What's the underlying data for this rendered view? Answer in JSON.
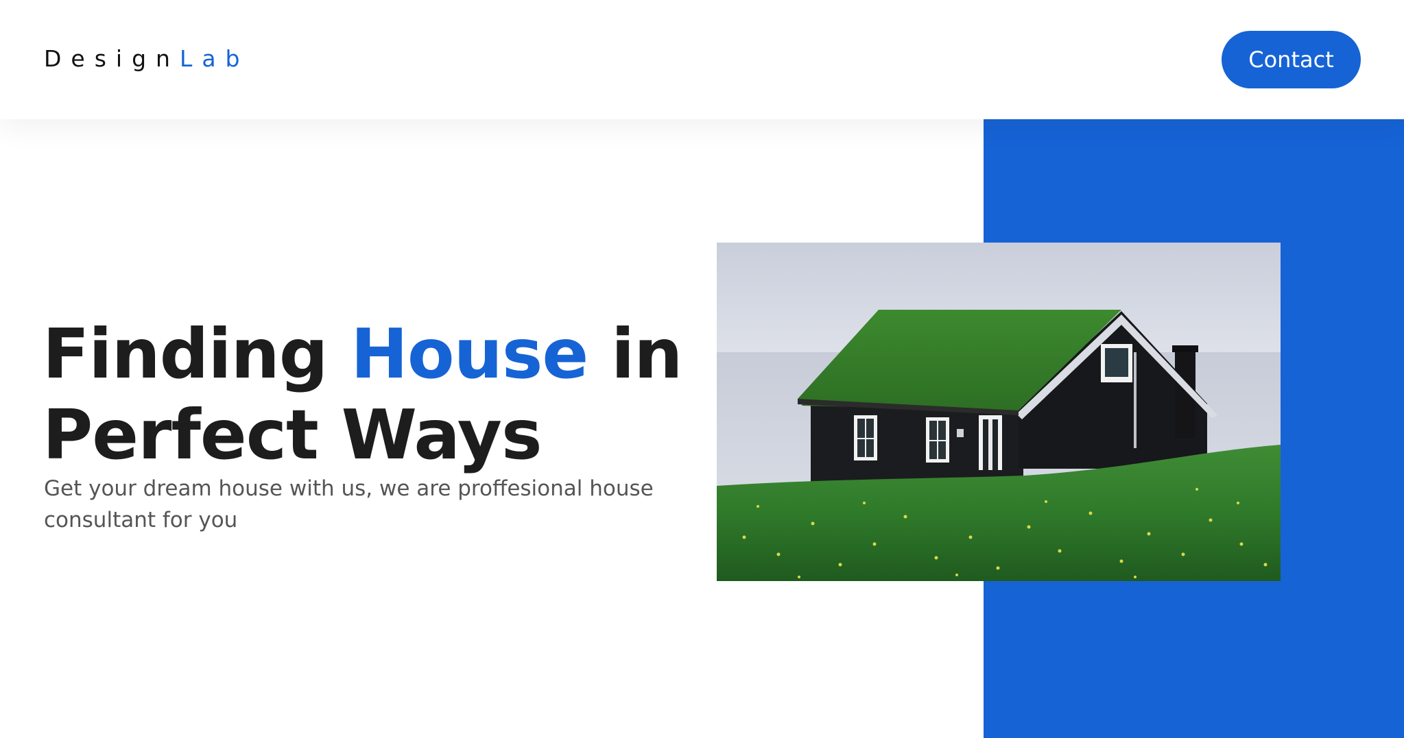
{
  "header": {
    "logo": {
      "part1": "Design",
      "part2": "Lab"
    },
    "contact_label": "Contact"
  },
  "hero": {
    "title_part1": "Finding ",
    "title_accent": "House",
    "title_part2": " in",
    "title_line2": "Perfect Ways",
    "subtitle": "Get your dream house with us, we are proffesional house consultant for you",
    "image_subject": "black-house-with-grass-roof"
  },
  "colors": {
    "accent": "#1663d6",
    "heading": "#1d1d1d",
    "body_text": "#555555",
    "background": "#ffffff"
  }
}
